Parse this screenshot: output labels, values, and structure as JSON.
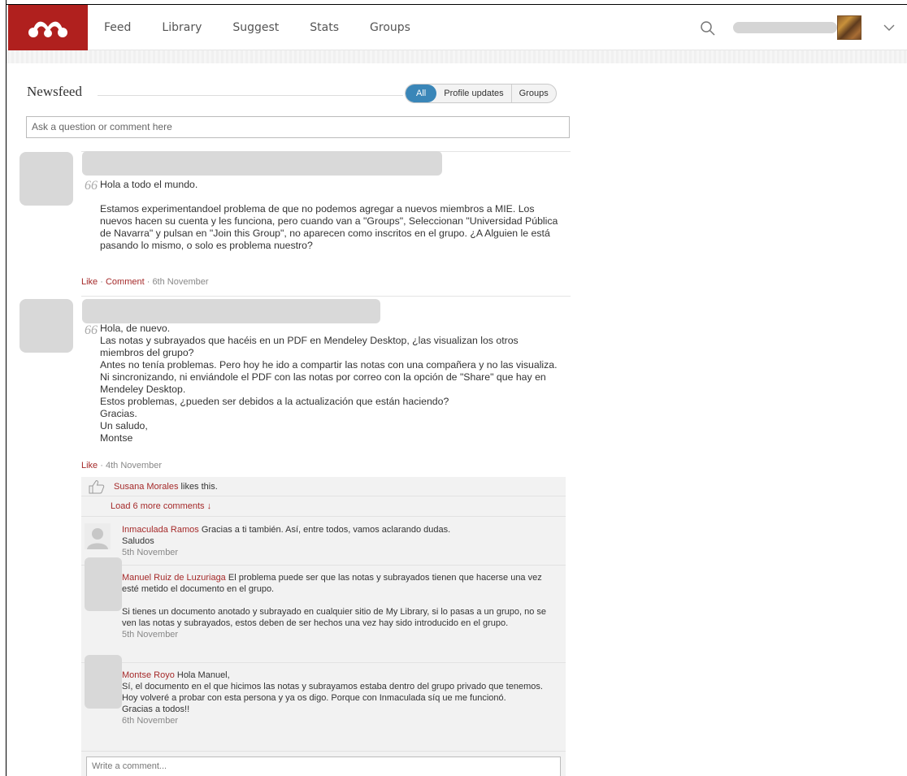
{
  "nav": {
    "items": [
      "Feed",
      "Library",
      "Suggest",
      "Stats",
      "Groups"
    ]
  },
  "newsfeed": {
    "title": "Newsfeed",
    "filters": [
      "All",
      "Profile updates",
      "Groups"
    ],
    "ask_placeholder": "Ask a question or comment here"
  },
  "posts": [
    {
      "quote": "66",
      "text": "Hola a todo el mundo.\n\nEstamos experimentandoel problema de que no podemos agregar a nuevos miembros a MIE. Los nuevos hacen su cuenta y les funciona, pero cuando van a \"Groups\", Seleccionan \"Universidad Pública de Navarra\" y pulsan en \"Join this Group\", no aparecen como inscritos en el grupo. ¿A Alguien le está pasando lo mismo, o solo es problema nuestro?",
      "like": "Like",
      "comment": "Comment",
      "date": "6th November"
    },
    {
      "quote": "66",
      "text": "Hola, de nuevo.\nLas notas y subrayados que hacéis en un PDF en Mendeley Desktop, ¿las visualizan los otros miembros del grupo?\nAntes no tenía problemas. Pero hoy he ido a compartir las notas con una compañera y no las visualiza. Ni sincronizando, ni enviándole el PDF con las notas por correo con la opción de \"Share\" que hay en Mendeley Desktop.\nEstos problemas, ¿pueden ser debidos a la actualización que están haciendo?\nGracias.\nUn saludo,\nMontse",
      "like": "Like",
      "date": "4th November"
    }
  ],
  "likes": {
    "name": "Susana Morales",
    "suffix": " likes this."
  },
  "load_more": "Load 6 more comments ↓",
  "comments": [
    {
      "author": "Inmaculada Ramos",
      "text": " Gracias a ti también. Así, entre todos, vamos aclarando dudas.\nSaludos",
      "date": "5th November"
    },
    {
      "author": "Manuel Ruiz de Luzuriaga",
      "text": " El problema puede ser que las notas y subrayados tienen que hacerse una vez esté metido el documento en el grupo.\n\nSi tienes un documento anotado y subrayado en cualquier sitio de My Library, si lo pasas a un grupo, no se ven las notas y subrayados, estos deben de ser hechos una vez hay sido introducido en el grupo.",
      "date": "5th November"
    },
    {
      "author": "Montse Royo",
      "text": " Hola Manuel,\nSí, el documento en el que hicimos las notas y subrayamos estaba dentro del grupo privado que tenemos. Hoy volveré a probar con esta persona y ya os digo. Porque con Inmaculada síq ue me funcionó.\nGracias a todos!!",
      "date": "6th November"
    }
  ],
  "write_placeholder": "Write a comment...",
  "colors": {
    "brand": "#b0201e",
    "accent": "#3a86b8",
    "link": "#a52a2a"
  }
}
